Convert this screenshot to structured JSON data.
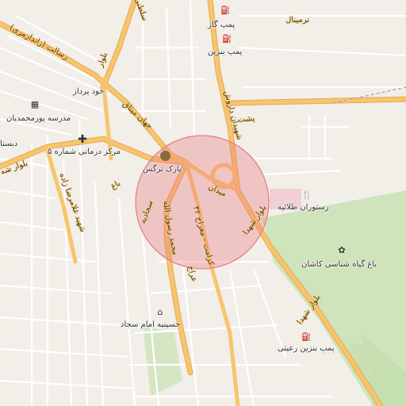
{
  "colors": {
    "background": "#f2efe9",
    "major_road": "#f7c56e",
    "minor_road": "#ffffff",
    "park": "#c8e0b4",
    "radius_fill": "rgba(234,120,130,0.35)",
    "radius_stroke": "#e67b82"
  },
  "pois": {
    "gas1": {
      "label": "پمپ گاز",
      "icon": "fuel-icon"
    },
    "gas2": {
      "label": "پمپ بنزین",
      "icon": "fuel-icon"
    },
    "gas3": {
      "label": "پمپ بنزین رعیتی",
      "icon": "fuel-icon"
    },
    "school": {
      "label": "مدرسه پورمحمدیان",
      "icon": "school-icon"
    },
    "clinic": {
      "label": "مرکز درمانی شماره ۵",
      "icon": "medical-cross-icon"
    },
    "park": {
      "label": "پارک نرگس",
      "icon": "tree-icon"
    },
    "restaurant": {
      "label": "رستوران طلائیه",
      "icon": "cutlery-icon"
    },
    "garden": {
      "label": "باغ گیاه شناسی کاشان",
      "icon": "flower-icon"
    },
    "hosseinieh": {
      "label": "حسینیه امام سجاد",
      "icon": "mosque-icon"
    },
    "khodpardaz": {
      "label": "خود پرداز"
    },
    "dabestan": {
      "label": "دبستا"
    }
  },
  "roads": {
    "r1": "بلوار شهدا",
    "r2": "بلوار شهدا",
    "r3": "شهیدان داروش",
    "r4": "میدان",
    "r5": "جهان میثاق",
    "r6": "شهید غلامرضا زاده",
    "r7": "رسالت (زاندارمری)",
    "r8": "محمد رسول الله",
    "r9": "کرامت - معراج ۴۲",
    "r10": "سجادیه",
    "r11": "بلوار شه",
    "r12": "باغ",
    "r13": "پشت",
    "r14": "ترمینال",
    "r15": "بلوار",
    "r16": "سلطنی",
    "r17": "عراج"
  }
}
